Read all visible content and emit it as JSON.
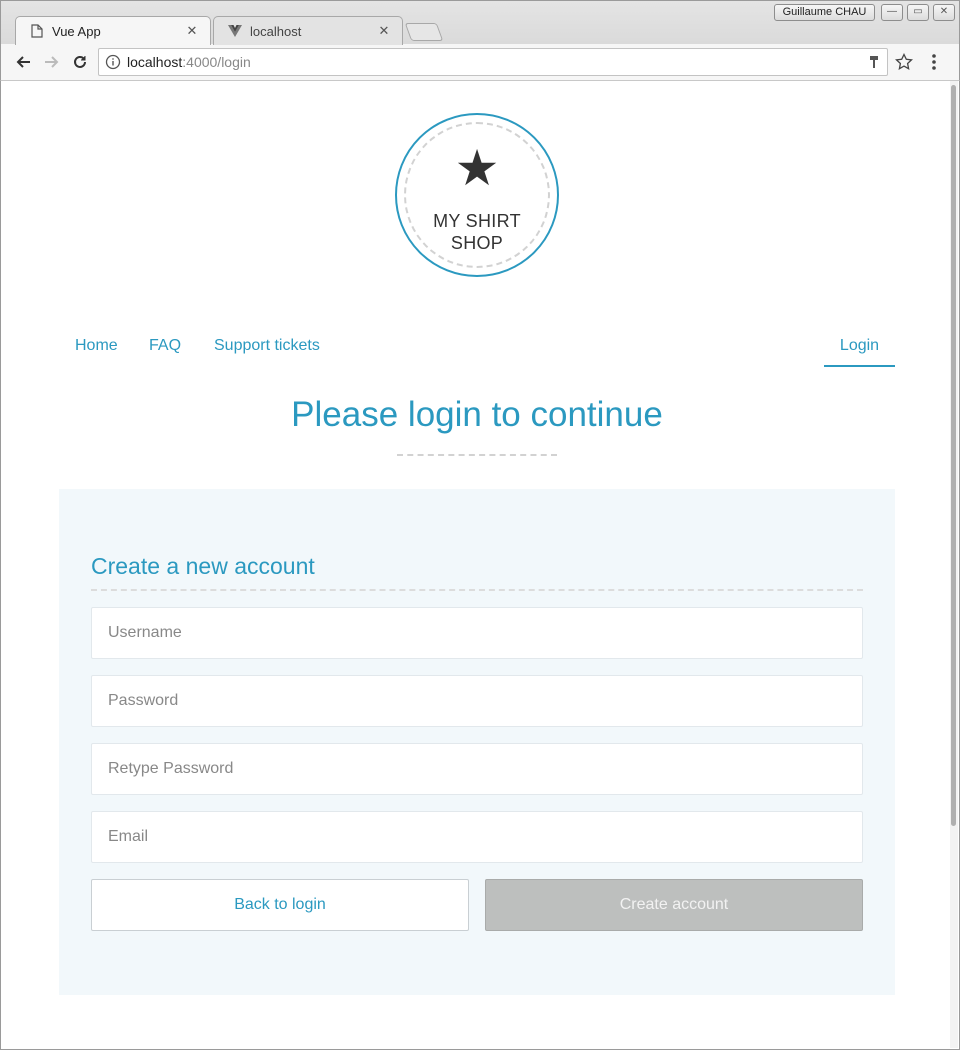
{
  "browser": {
    "tabs": [
      {
        "title": "Vue App",
        "active": true,
        "icon": "page-icon"
      },
      {
        "title": "localhost",
        "active": false,
        "icon": "vue-icon"
      }
    ],
    "profile_name": "Guillaume CHAU",
    "address": {
      "host": "localhost",
      "path": ":4000/login"
    }
  },
  "logo": {
    "line1": "MY SHIRT",
    "line2": "SHOP",
    "icon": "star-icon"
  },
  "nav": {
    "home": "Home",
    "faq": "FAQ",
    "support": "Support tickets",
    "login": "Login"
  },
  "page": {
    "title": "Please login to continue"
  },
  "form": {
    "title": "Create a new account",
    "username_placeholder": "Username",
    "password_placeholder": "Password",
    "retype_placeholder": "Retype Password",
    "email_placeholder": "Email",
    "back_label": "Back to login",
    "create_label": "Create account"
  },
  "colors": {
    "accent": "#2b99c0",
    "panel_bg": "#f2f8fb",
    "disabled_btn": "#bdbfbe"
  }
}
